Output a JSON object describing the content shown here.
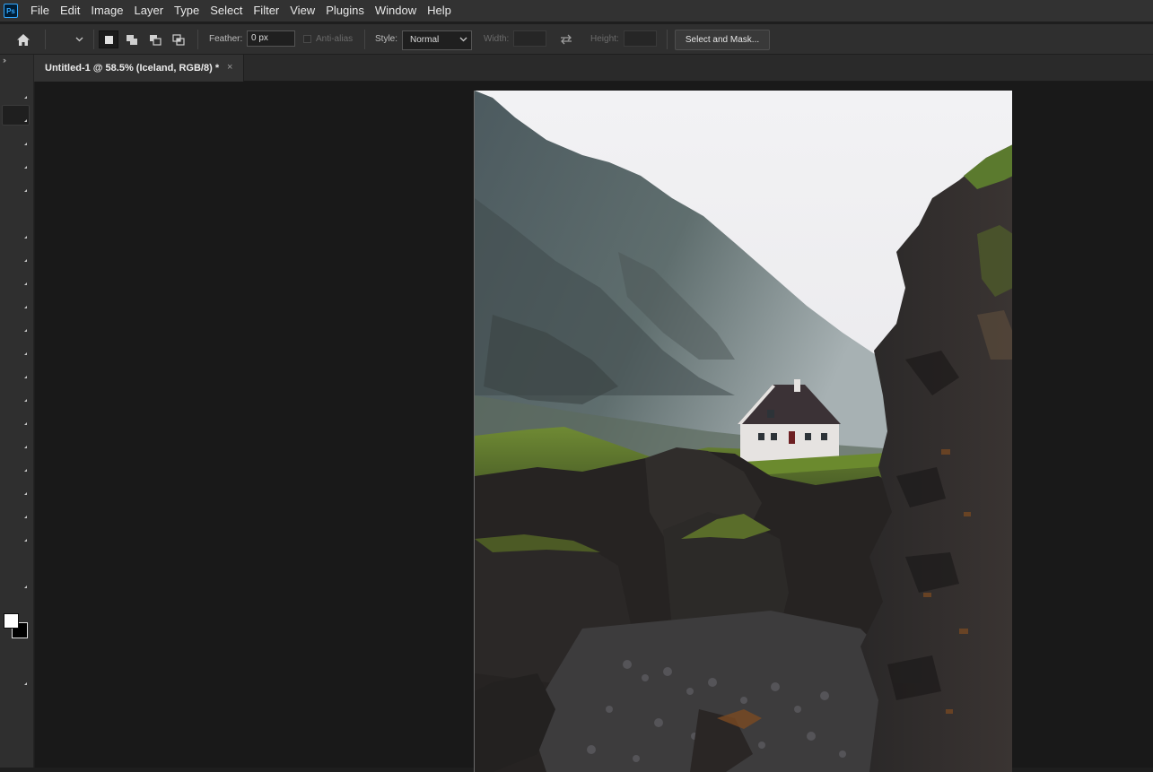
{
  "app": {
    "logo_text": "Ps"
  },
  "menu": [
    "File",
    "Edit",
    "Image",
    "Layer",
    "Type",
    "Select",
    "Filter",
    "View",
    "Plugins",
    "Window",
    "Help"
  ],
  "options": {
    "feather_label": "Feather:",
    "feather_value": "0 px",
    "antialias_label": "Anti-alias",
    "style_label": "Style:",
    "style_value": "Normal",
    "width_label": "Width:",
    "height_label": "Height:",
    "select_and_mask_label": "Select and Mask..."
  },
  "document": {
    "tab_title": "Untitled-1 @ 58.5% (Iceland, RGB/8) *",
    "close_glyph": "×"
  },
  "toolbar": {
    "collapse_glyph": "››"
  },
  "colors": {
    "foreground": "#ffffff",
    "background": "#000000",
    "accent": "#31a8ff"
  }
}
